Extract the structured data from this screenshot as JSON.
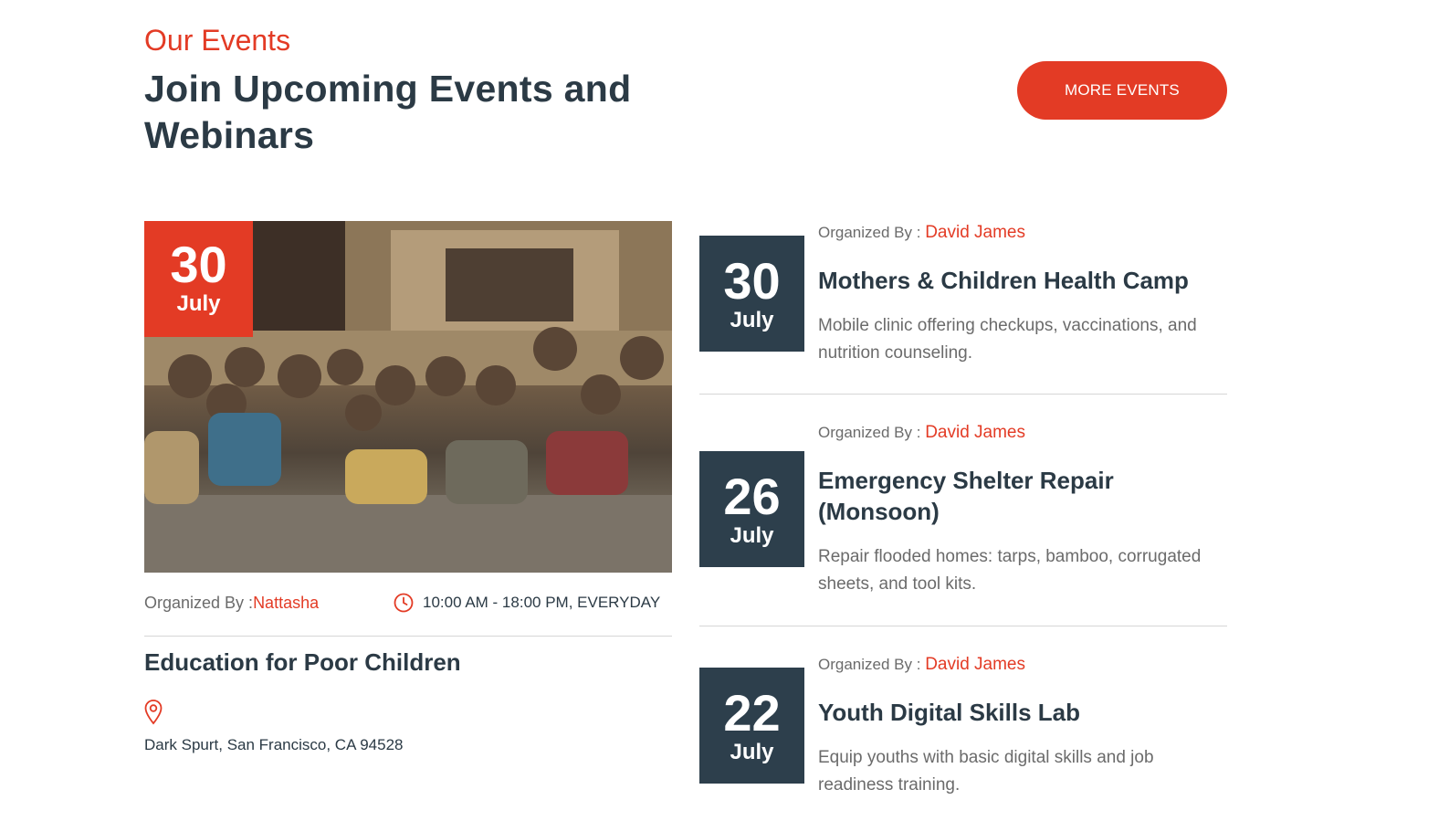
{
  "section": {
    "eyebrow": "Our Events",
    "heading": "Join Upcoming Events and Webinars",
    "more_button": "MORE EVENTS"
  },
  "featured": {
    "date_day": "30",
    "date_month": "July",
    "organizer_label": "Organized By :",
    "organizer_name": "Nattasha",
    "time": "10:00 AM - 18:00 PM, EVERYDAY",
    "title": "Education for Poor Children",
    "address": "Dark Spurt, San Francisco, CA 94528"
  },
  "events": [
    {
      "organizer_label": "Organized By :",
      "organizer_name": "David James",
      "date_day": "30",
      "date_month": "July",
      "title": "Mothers & Children Health Camp",
      "description": "Mobile clinic offering checkups, vaccinations, and nutrition counseling."
    },
    {
      "organizer_label": "Organized By :",
      "organizer_name": "David James",
      "date_day": "26",
      "date_month": "July",
      "title": "Emergency Shelter Repair (Monsoon)",
      "description": "Repair flooded homes: tarps, bamboo, corrugated sheets, and tool kits."
    },
    {
      "organizer_label": "Organized By :",
      "organizer_name": "David James",
      "date_day": "22",
      "date_month": "July",
      "title": "Youth Digital Skills Lab",
      "description": "Equip youths with basic digital skills and job readiness training."
    }
  ],
  "icons": {
    "clock": "clock-icon",
    "location": "map-pin-icon"
  },
  "colors": {
    "accent": "#e33b25",
    "dark": "#2d3f4c",
    "text": "#2b3a45",
    "muted": "#6b6b6b"
  }
}
